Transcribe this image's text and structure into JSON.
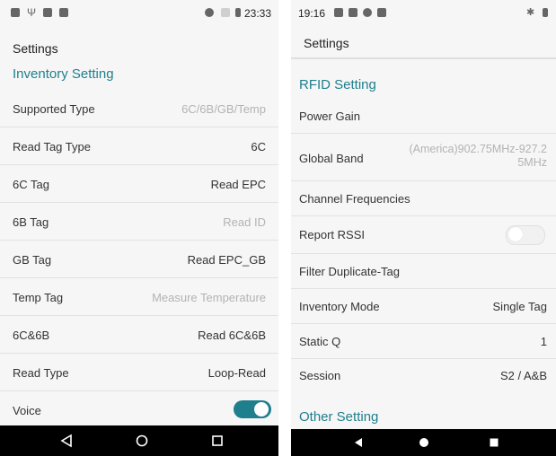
{
  "left": {
    "status": {
      "time": "23:33"
    },
    "appbar": {
      "title": "Settings"
    },
    "section": "Inventory Setting",
    "rows": [
      {
        "label": "Supported Type",
        "value": "6C/6B/GB/Temp"
      },
      {
        "label": "Read Tag Type",
        "value": "6C"
      },
      {
        "label": "6C Tag",
        "value": "Read EPC"
      },
      {
        "label": "6B Tag",
        "value": "Read ID"
      },
      {
        "label": "GB Tag",
        "value": "Read EPC_GB"
      },
      {
        "label": "Temp Tag",
        "value": "Measure Temperature"
      },
      {
        "label": "6C&6B",
        "value": "Read 6C&6B"
      },
      {
        "label": "Read Type",
        "value": "Loop-Read"
      },
      {
        "label": "Voice",
        "value": "",
        "toggle": "on"
      }
    ]
  },
  "right": {
    "status": {
      "time": "19:16"
    },
    "appbar": {
      "title": "Settings"
    },
    "section": "RFID Setting",
    "rows": [
      {
        "label": "Power Gain",
        "value": ""
      },
      {
        "label": "Global Band",
        "value": "(America)902.75MHz-927.2\n5MHz"
      },
      {
        "label": "Channel Frequencies",
        "value": ""
      },
      {
        "label": "Report RSSI",
        "value": "",
        "toggle": "off"
      },
      {
        "label": "Filter Duplicate-Tag",
        "value": ""
      },
      {
        "label": "Inventory Mode",
        "value": "Single Tag"
      },
      {
        "label": "Static Q",
        "value": "1"
      },
      {
        "label": "Session",
        "value": "S2 / A&B"
      }
    ],
    "section2": "Other Setting"
  },
  "colors": {
    "accent": "#1f7f8c",
    "navbar": "#000000",
    "background": "#f6f6f6"
  },
  "icons": [
    "back-icon",
    "home-icon",
    "recents-icon"
  ]
}
